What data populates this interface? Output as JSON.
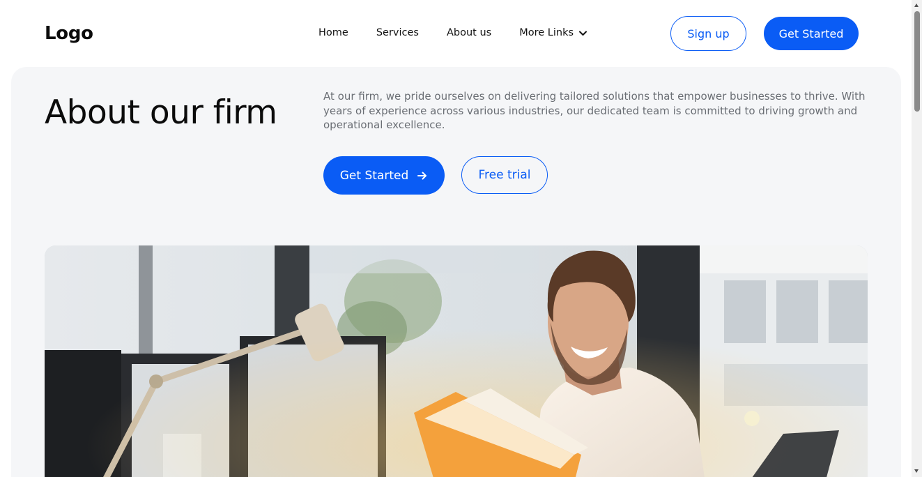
{
  "header": {
    "logo": "Logo",
    "nav": [
      {
        "label": "Home"
      },
      {
        "label": "Services"
      },
      {
        "label": "About us"
      }
    ],
    "more_links": {
      "label": "More Links",
      "icon": "chevron-down-icon"
    },
    "signup_label": "Sign up",
    "get_started_label": "Get Started"
  },
  "hero": {
    "title": "About our firm",
    "description": "At our firm, we pride ourselves on delivering tailored solutions that empower businesses to thrive. With years of experience across various industries, our dedicated team is committed to driving growth and operational excellence.",
    "primary_button": {
      "label": "Get Started",
      "icon": "arrow-right-icon"
    },
    "secondary_button": {
      "label": "Free trial"
    },
    "image": {
      "subject": "smiling man reading a book at office desk with lamp and monitors"
    }
  },
  "colors": {
    "accent": "#0a5cf5",
    "hero_background": "#f5f6f8",
    "body_text": "#6a6e74"
  }
}
